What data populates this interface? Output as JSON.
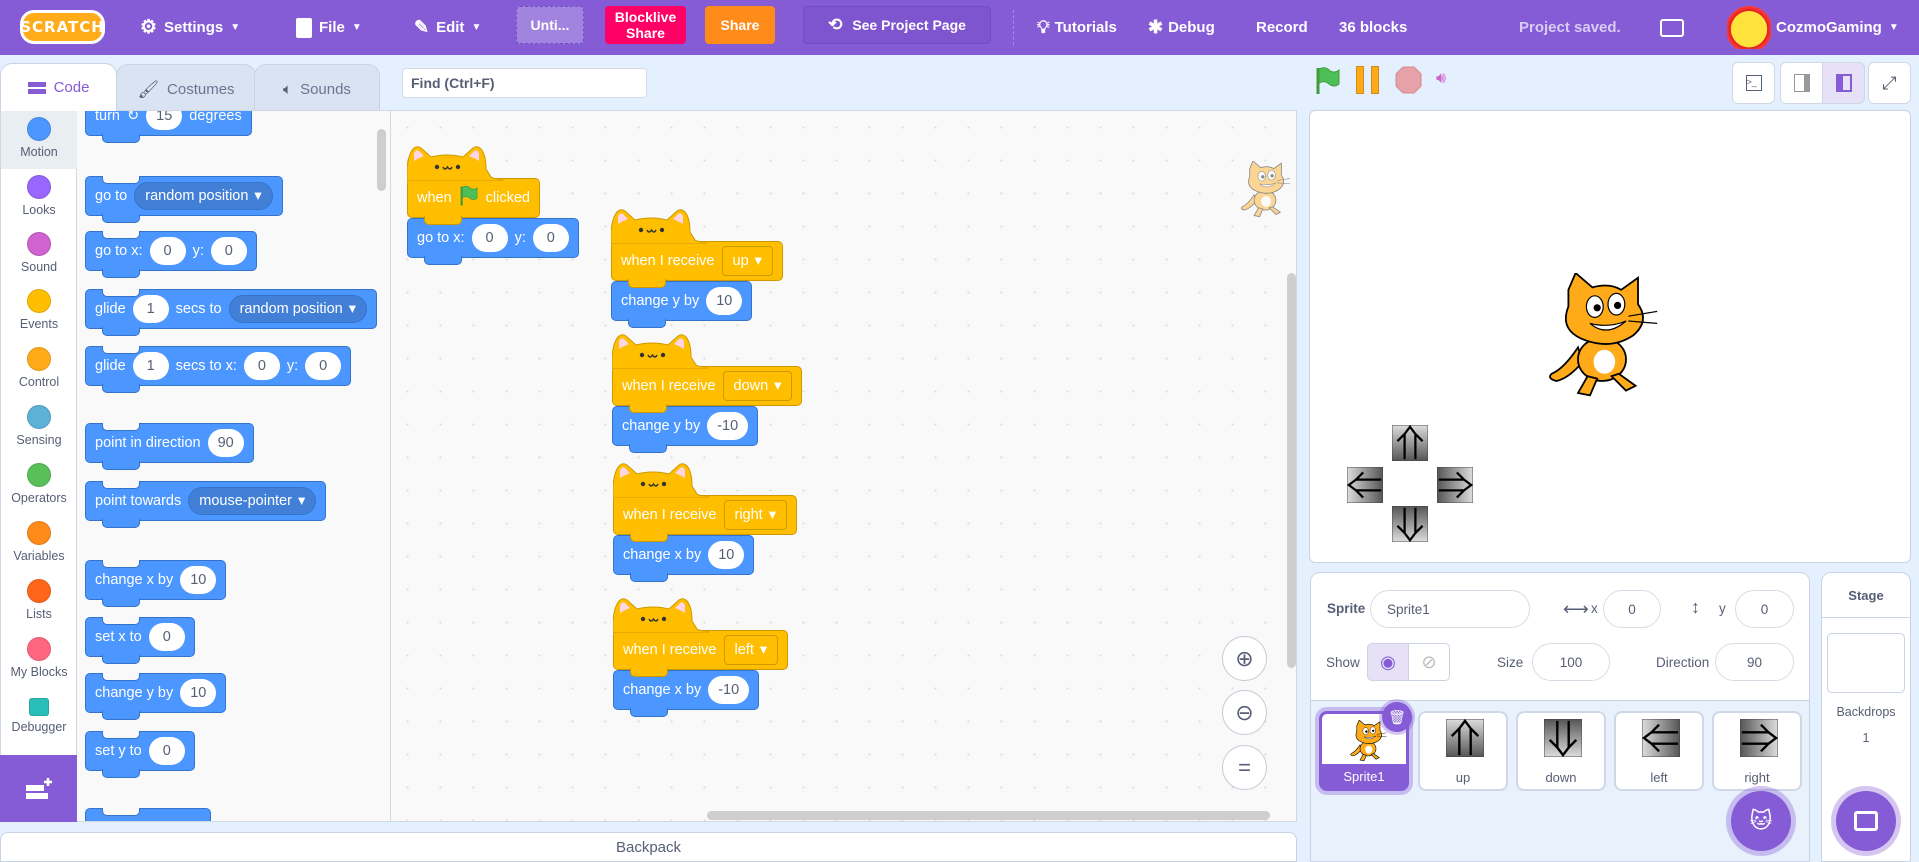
{
  "menu": {
    "logo": "SCRATCH",
    "settings": "Settings",
    "file": "File",
    "edit": "Edit",
    "project_title": "Unti...",
    "blocklive_line1": "Blocklive",
    "blocklive_line2": "Share",
    "share": "Share",
    "see_project": "See Project Page",
    "tutorials": "Tutorials",
    "debug": "Debug",
    "record": "Record",
    "block_count": "36 blocks",
    "save_status": "Project saved.",
    "username": "CozmoGaming"
  },
  "tabs": {
    "code": "Code",
    "costumes": "Costumes",
    "sounds": "Sounds"
  },
  "find": {
    "placeholder": "Find (Ctrl+F)"
  },
  "categories": [
    {
      "label": "Motion",
      "color": "#4c97ff"
    },
    {
      "label": "Looks",
      "color": "#9966ff"
    },
    {
      "label": "Sound",
      "color": "#cf63cf"
    },
    {
      "label": "Events",
      "color": "#ffbf00"
    },
    {
      "label": "Control",
      "color": "#ffab19"
    },
    {
      "label": "Sensing",
      "color": "#5cb1d6"
    },
    {
      "label": "Operators",
      "color": "#59c059"
    },
    {
      "label": "Variables",
      "color": "#ff8c1a"
    },
    {
      "label": "Lists",
      "color": "#ff661a"
    },
    {
      "label": "My Blocks",
      "color": "#ff6680"
    },
    {
      "label": "Debugger",
      "color": "#29beb8"
    }
  ],
  "palette": [
    [
      [
        "t",
        "turn"
      ],
      [
        "i",
        "↻"
      ],
      [
        "n",
        "15"
      ],
      [
        "t",
        "degrees"
      ]
    ],
    [
      [
        "t",
        "go to"
      ],
      [
        "d",
        "random position"
      ]
    ],
    [
      [
        "t",
        "go to x:"
      ],
      [
        "n",
        "0"
      ],
      [
        "t",
        "y:"
      ],
      [
        "n",
        "0"
      ]
    ],
    [
      [
        "t",
        "glide"
      ],
      [
        "n",
        "1"
      ],
      [
        "t",
        "secs to"
      ],
      [
        "d",
        "random position"
      ]
    ],
    [
      [
        "t",
        "glide"
      ],
      [
        "n",
        "1"
      ],
      [
        "t",
        "secs to x:"
      ],
      [
        "n",
        "0"
      ],
      [
        "t",
        "y:"
      ],
      [
        "n",
        "0"
      ]
    ],
    [
      [
        "t",
        "point in direction"
      ],
      [
        "n",
        "90"
      ]
    ],
    [
      [
        "t",
        "point towards"
      ],
      [
        "d",
        "mouse-pointer"
      ]
    ],
    [
      [
        "t",
        "change x by"
      ],
      [
        "n",
        "10"
      ]
    ],
    [
      [
        "t",
        "set x to"
      ],
      [
        "n",
        "0"
      ]
    ],
    [
      [
        "t",
        "change y by"
      ],
      [
        "n",
        "10"
      ]
    ],
    [
      [
        "t",
        "set y to"
      ],
      [
        "n",
        "0"
      ]
    ],
    []
  ],
  "scripts": [
    {
      "hat": [
        [
          "t",
          "when"
        ],
        [
          "flag",
          ""
        ],
        [
          "t",
          "clicked"
        ]
      ],
      "body": [
        [
          "t",
          "go to x:"
        ],
        [
          "n",
          "0"
        ],
        [
          "t",
          "y:"
        ],
        [
          "n",
          "0"
        ]
      ]
    },
    {
      "hat": [
        [
          "t",
          "when I receive"
        ],
        [
          "e",
          "up"
        ]
      ],
      "body": [
        [
          "t",
          "change y by"
        ],
        [
          "n",
          "10"
        ]
      ]
    },
    {
      "hat": [
        [
          "t",
          "when I receive"
        ],
        [
          "e",
          "down"
        ]
      ],
      "body": [
        [
          "t",
          "change y by"
        ],
        [
          "n",
          "-10"
        ]
      ]
    },
    {
      "hat": [
        [
          "t",
          "when I receive"
        ],
        [
          "e",
          "right"
        ]
      ],
      "body": [
        [
          "t",
          "change x by"
        ],
        [
          "n",
          "10"
        ]
      ]
    },
    {
      "hat": [
        [
          "t",
          "when I receive"
        ],
        [
          "e",
          "left"
        ]
      ],
      "body": [
        [
          "t",
          "change x by"
        ],
        [
          "n",
          "-10"
        ]
      ]
    }
  ],
  "sprite_info": {
    "sprite_label": "Sprite",
    "sprite_name": "Sprite1",
    "x_label": "x",
    "x_value": "0",
    "y_label": "y",
    "y_value": "0",
    "show_label": "Show",
    "size_label": "Size",
    "size_value": "100",
    "direction_label": "Direction",
    "direction_value": "90"
  },
  "sprites": [
    {
      "name": "Sprite1",
      "icon": "cat",
      "selected": true
    },
    {
      "name": "up",
      "icon": "up"
    },
    {
      "name": "down",
      "icon": "down"
    },
    {
      "name": "left",
      "icon": "left"
    },
    {
      "name": "right",
      "icon": "right"
    }
  ],
  "stage_pane": {
    "title": "Stage",
    "backdrops_label": "Backdrops",
    "backdrops_count": "1"
  },
  "backpack": "Backpack",
  "colors": {
    "menu": "#855cd6",
    "motion": "#4c97ff",
    "events": "#ffbf00",
    "blocklive": "#ff0066",
    "share": "#ff8c1a"
  }
}
